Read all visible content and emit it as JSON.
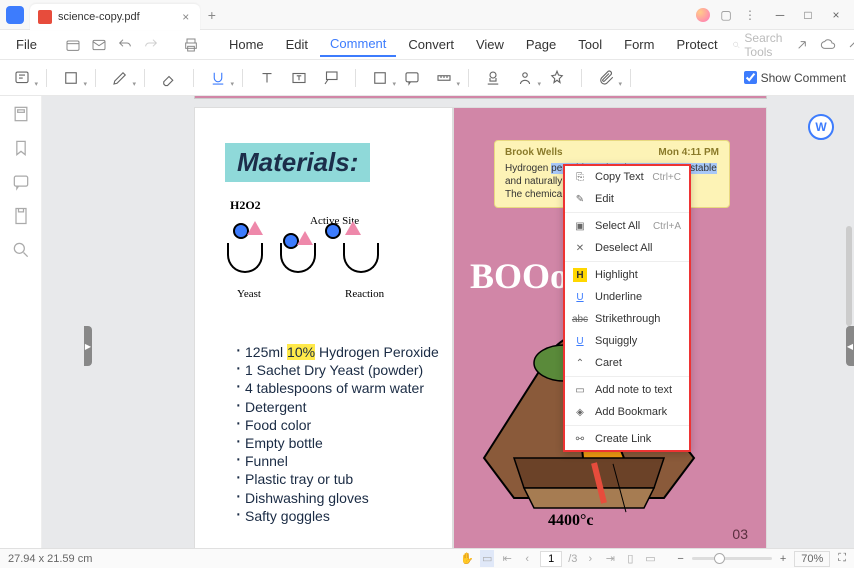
{
  "tab": {
    "title": "science-copy.pdf"
  },
  "menu": {
    "file": "File",
    "items": [
      "Home",
      "Edit",
      "Comment",
      "Convert",
      "View",
      "Page",
      "Tool",
      "Form",
      "Protect"
    ],
    "active": 2,
    "search_placeholder": "Search Tools"
  },
  "toolbar": {
    "show_comment": "Show Comment"
  },
  "document": {
    "materials_heading": "Materials:",
    "diagram": {
      "h2o2": "H2O2",
      "active_site": "Active Site",
      "yeast": "Yeast",
      "reaction": "Reaction"
    },
    "list": {
      "item1_a": "125ml ",
      "item1_hl": "10%",
      "item1_b": " Hydrogen Peroxide",
      "items_rest": [
        "1 Sachet Dry Yeast (powder)",
        "4 tablespoons of warm water",
        "Detergent",
        "Food color",
        "Empty bottle",
        "Funnel",
        "Plastic tray or tub",
        "Dishwashing gloves",
        "Safty goggles"
      ]
    },
    "boo": "BOOoo",
    "temp": "4400°c",
    "page_number": "03"
  },
  "note": {
    "author": "Brook Wells",
    "time": "Mon 4:11 PM",
    "body_pre": "Hydrogen ",
    "body_sel": "peroxide molecules are very unstable",
    "body_post": " and naturally deco",
    "body_line2": "The chemica"
  },
  "ctx": {
    "copy": "Copy Text",
    "copy_sc": "Ctrl+C",
    "edit": "Edit",
    "selall": "Select All",
    "selall_sc": "Ctrl+A",
    "deselall": "Deselect All",
    "highlight": "Highlight",
    "underline": "Underline",
    "strike": "Strikethrough",
    "squiggly": "Squiggly",
    "caret": "Caret",
    "addnote": "Add note to text",
    "bookmark": "Add Bookmark",
    "link": "Create Link"
  },
  "status": {
    "dims": "27.94 x 21.59 cm",
    "page_current": "1",
    "page_total": "/3",
    "zoom": "70%"
  }
}
